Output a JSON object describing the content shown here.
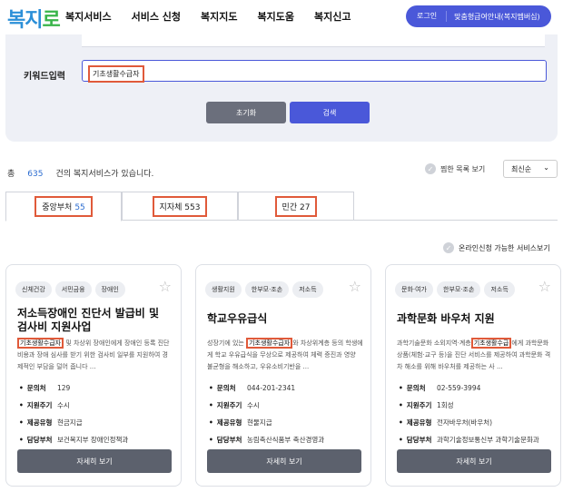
{
  "header": {
    "logo_main": "복지",
    "logo_sub": "로",
    "nav": [
      "복지서비스",
      "서비스 신청",
      "복지지도",
      "복지도움",
      "복지신고"
    ],
    "login_label": "로그인",
    "guide_label": "맞춤형급여안내(복지멤버십)"
  },
  "search": {
    "keyword_label": "키워드입력",
    "keyword_value": "기초생활수급자",
    "reset_label": "초기화",
    "search_label": "검색"
  },
  "results": {
    "prefix": "총",
    "count": "635",
    "suffix": "건의 복지서비스가 있습니다.",
    "fav_label": "찜한 목록 보기",
    "sort_value": "최신순",
    "online_label": "온라인신청 가능한 서비스보기"
  },
  "tabs": [
    {
      "label": "중앙부처",
      "count": "55"
    },
    {
      "label": "지자체",
      "count": "553"
    },
    {
      "label": "민간",
      "count": "27"
    }
  ],
  "cards": [
    {
      "tags": [
        "신체건강",
        "서민금융",
        "장애인"
      ],
      "title": "저소득장애인 진단서 발급비 및 검사비 지원사업",
      "desc_hl": "기초생활수급자",
      "desc_rest": " 및 차상위 장애인에게 장애인 등록 진단 비용과 장애 심사를 받기 위한 검사비 일부를 지원하여 경제적인 부담을 덜어 줍니다 ...",
      "info": [
        {
          "key": "문의처",
          "val": "129"
        },
        {
          "key": "지원주기",
          "val": "수시"
        },
        {
          "key": "제공유형",
          "val": "현금지급"
        },
        {
          "key": "담당부처",
          "val": "보건복지부 장애인정책과"
        }
      ],
      "detail_label": "자세히 보기"
    },
    {
      "tags": [
        "생활지원",
        "한부모·조손",
        "저소득"
      ],
      "title": "학교우유급식",
      "desc_pre": "성장기에 있는 ",
      "desc_hl": "기초생활수급자",
      "desc_rest": "와 차상위계층 등의 학생에게 학교 우유급식을 무상으로 제공하여 체력 증진과 영양 불균형을 해소하고, 우유소비기반을 ...",
      "info": [
        {
          "key": "문의처",
          "val": "044-201-2341"
        },
        {
          "key": "지원주기",
          "val": "수시"
        },
        {
          "key": "제공유형",
          "val": "현물지급"
        },
        {
          "key": "담당부처",
          "val": "농림축산식품부 축산경영과"
        }
      ],
      "detail_label": "자세히 보기"
    },
    {
      "tags": [
        "문화·여가",
        "한부모·조손",
        "저소득"
      ],
      "title": "과학문화 바우처 지원",
      "desc_pre": "과학기술문화 소외지역·계층",
      "desc_hl": "기초생활수급",
      "desc_rest": "에게 과학문화 상품(체험·교구 등)을 진단 서비스를 제공하여 과학문화 격차 해소를 위해 바우처를 제공하는 사 ...",
      "info": [
        {
          "key": "문의처",
          "val": "02-559-3994"
        },
        {
          "key": "지원주기",
          "val": "1회성"
        },
        {
          "key": "제공유형",
          "val": "전자바우처(바우처)"
        },
        {
          "key": "담당부처",
          "val": "과학기술정보통신부 과학기술문화과"
        }
      ],
      "detail_label": "자세히 보기"
    }
  ],
  "colors": {
    "accent": "#4a58d9",
    "highlight": "#e05a3a",
    "count": "#2b6cd0"
  }
}
